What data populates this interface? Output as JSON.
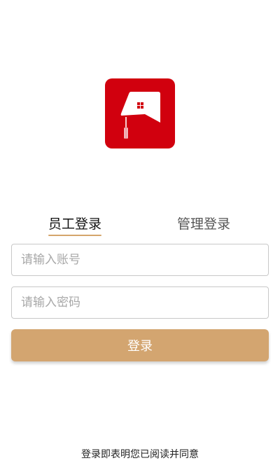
{
  "tabs": {
    "staff_login": "员工登录",
    "admin_login": "管理登录",
    "active": "staff_login"
  },
  "form": {
    "account_placeholder": "请输入账号",
    "account_value": "",
    "password_placeholder": "请输入密码",
    "password_value": "",
    "submit_label": "登录"
  },
  "footer": {
    "agreement_text": "登录即表明您已阅读并同意"
  },
  "icons": {
    "logo": "graduation-cap-logo-icon"
  },
  "colors": {
    "logo_background": "#d1000e",
    "accent": "#d3a570",
    "input_border": "#c8c8c8"
  }
}
